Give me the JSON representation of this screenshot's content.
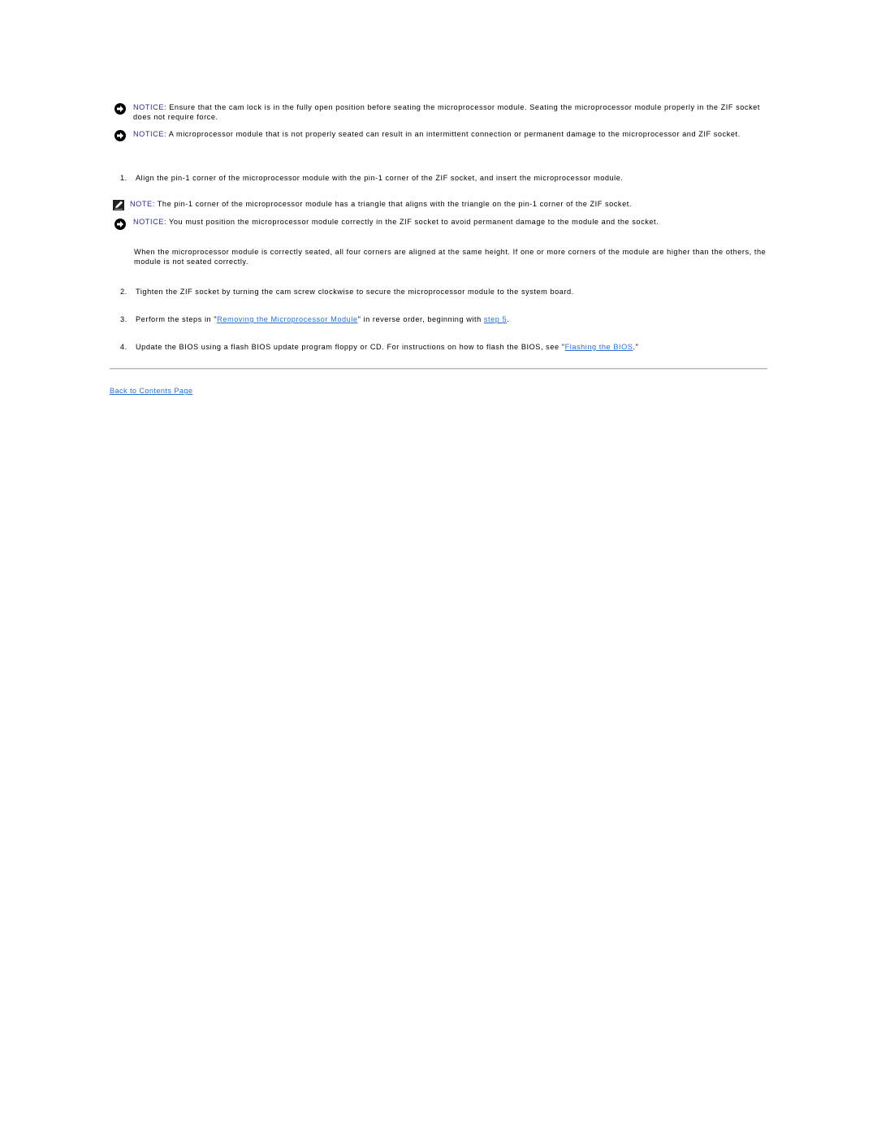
{
  "notices_top": [
    {
      "type": "notice",
      "label": "NOTICE:",
      "text": " Ensure that the cam lock is in the fully open position before seating the microprocessor module. Seating the microprocessor module properly in the ZIF socket does not require force."
    },
    {
      "type": "notice",
      "label": "NOTICE:",
      "text": " A microprocessor module that is not properly seated can result in an intermittent connection or permanent damage to the microprocessor and ZIF socket."
    }
  ],
  "steps": [
    {
      "number": "1.",
      "text": "Align the pin-1 corner of the microprocessor module with the pin-1 corner of the ZIF socket, and insert the microprocessor module."
    },
    {
      "number": "2.",
      "text": "Tighten the ZIF socket by turning the cam screw clockwise to secure the microprocessor module to the system board."
    },
    {
      "number": "3.",
      "text_before": "Perform the steps in \"",
      "link1": "Removing the Microprocessor Module",
      "text_middle": "\" in reverse order, beginning with ",
      "link2": "step 5",
      "text_after": "."
    },
    {
      "number": "4.",
      "text_before": "Update the BIOS using a flash BIOS update program floppy or CD. For instructions on how to flash the BIOS, see \"",
      "link1": "Flashing the BIOS",
      "text_after": ".\""
    }
  ],
  "step1_callouts": [
    {
      "type": "note",
      "label": "NOTE:",
      "text": " The pin-1 corner of the microprocessor module has a triangle that aligns with the triangle on the pin-1 corner of the ZIF socket."
    },
    {
      "type": "notice",
      "label": "NOTICE:",
      "text": " You must position the microprocessor module correctly in the ZIF socket to avoid permanent damage to the module and the socket."
    }
  ],
  "step1_paragraph": "When the microprocessor module is correctly seated, all four corners are aligned at the same height. If one or more corners of the module are higher than the others, the module is not seated correctly.",
  "footer": {
    "back_link": "Back to Contents Page"
  },
  "colors": {
    "label": "#2a2a8e",
    "link": "#2a6ecf"
  }
}
